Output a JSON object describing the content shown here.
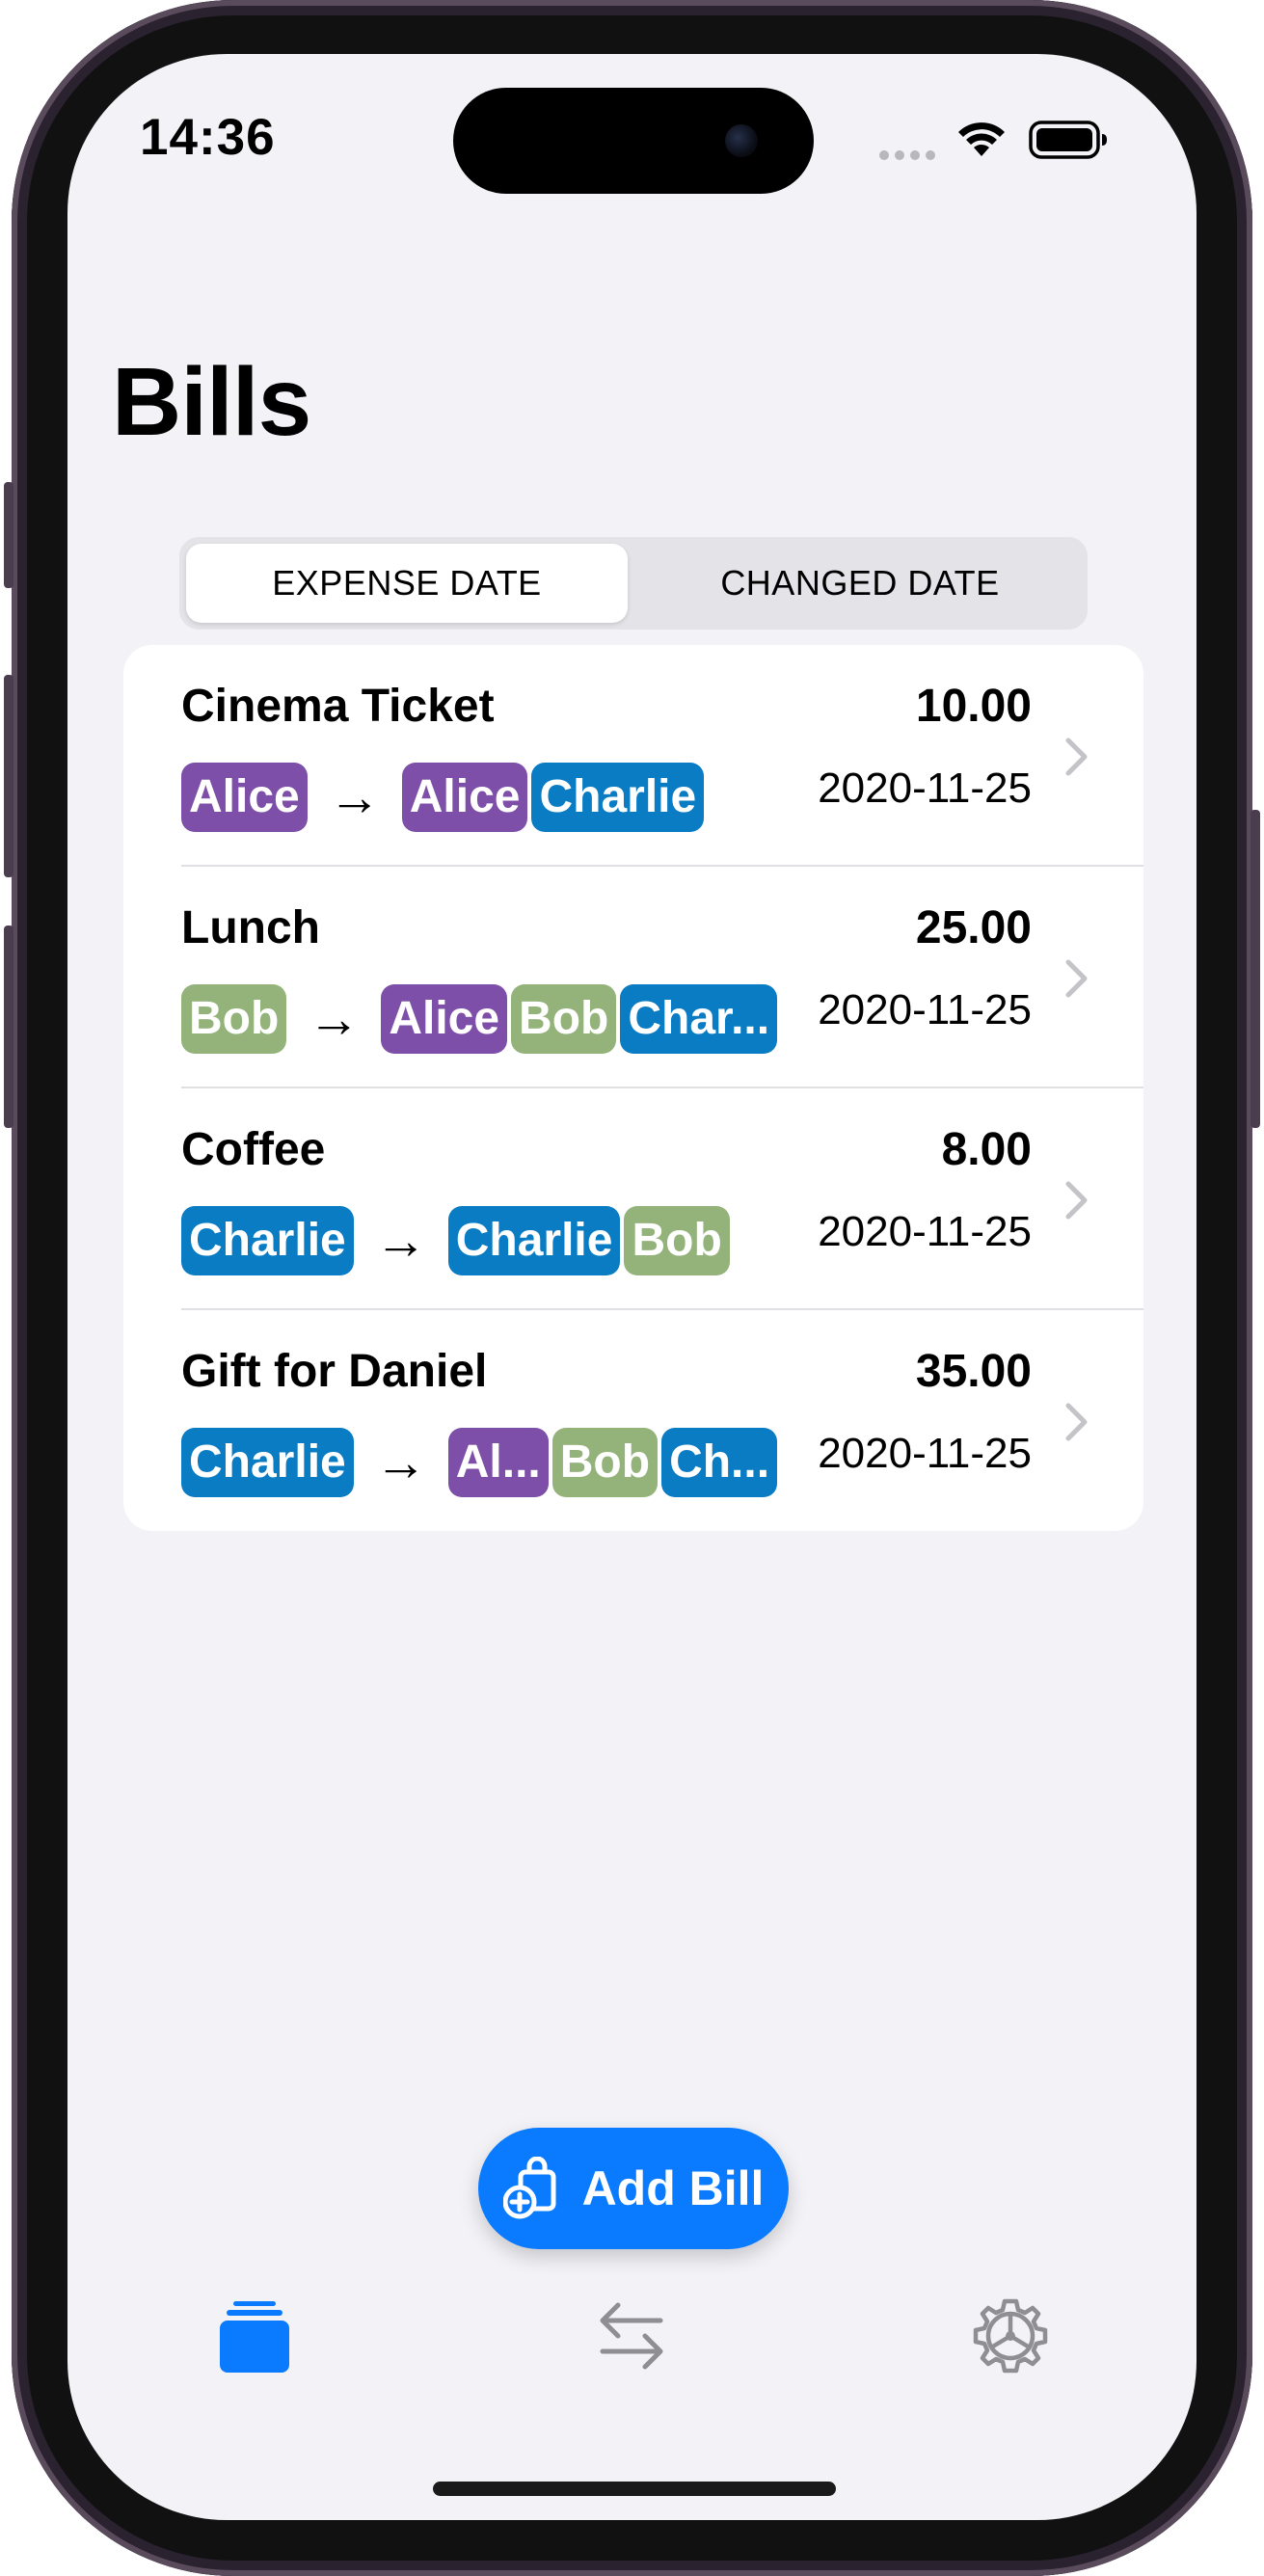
{
  "status_bar": {
    "time": "14:36"
  },
  "header": {
    "title": "Bills"
  },
  "segmented_control": {
    "options": [
      {
        "label": "EXPENSE DATE",
        "selected": true
      },
      {
        "label": "CHANGED DATE",
        "selected": false
      }
    ]
  },
  "bills": [
    {
      "name": "Cinema Ticket",
      "amount": "10.00",
      "date": "2020-11-25",
      "payer": [
        {
          "label": "Alice",
          "person": "alice"
        }
      ],
      "participants": [
        {
          "label": "Alice",
          "person": "alice"
        },
        {
          "label": "Charlie",
          "person": "charlie"
        }
      ]
    },
    {
      "name": "Lunch",
      "amount": "25.00",
      "date": "2020-11-25",
      "payer": [
        {
          "label": "Bob",
          "person": "bob"
        }
      ],
      "participants": [
        {
          "label": "Alice",
          "person": "alice"
        },
        {
          "label": "Bob",
          "person": "bob"
        },
        {
          "label": "Char...",
          "person": "charlie"
        }
      ]
    },
    {
      "name": "Coffee",
      "amount": "8.00",
      "date": "2020-11-25",
      "payer": [
        {
          "label": "Charlie",
          "person": "charlie"
        }
      ],
      "participants": [
        {
          "label": "Charlie",
          "person": "charlie"
        },
        {
          "label": "Bob",
          "person": "bob"
        }
      ]
    },
    {
      "name": "Gift for Daniel",
      "amount": "35.00",
      "date": "2020-11-25",
      "payer": [
        {
          "label": "Charlie",
          "person": "charlie"
        }
      ],
      "participants": [
        {
          "label": "Al...",
          "person": "alice"
        },
        {
          "label": "Bob",
          "person": "bob"
        },
        {
          "label": "Ch...",
          "person": "charlie"
        }
      ]
    }
  ],
  "people_colors": {
    "alice": "#7d4fa8",
    "bob": "#94b37a",
    "charlie": "#0a7cc4"
  },
  "arrow_glyph": "→",
  "add_bill_button": {
    "label": "Add Bill",
    "icon": "bag-plus-icon"
  },
  "tab_bar": {
    "tabs": [
      {
        "icon": "bills-stack-icon",
        "selected": true
      },
      {
        "icon": "transfer-arrows-icon",
        "selected": false
      },
      {
        "icon": "settings-gear-icon",
        "selected": false
      }
    ]
  },
  "colors": {
    "accent": "#0a7bff",
    "background": "#f2f2f7",
    "inactive_icon": "#8e8e93"
  }
}
